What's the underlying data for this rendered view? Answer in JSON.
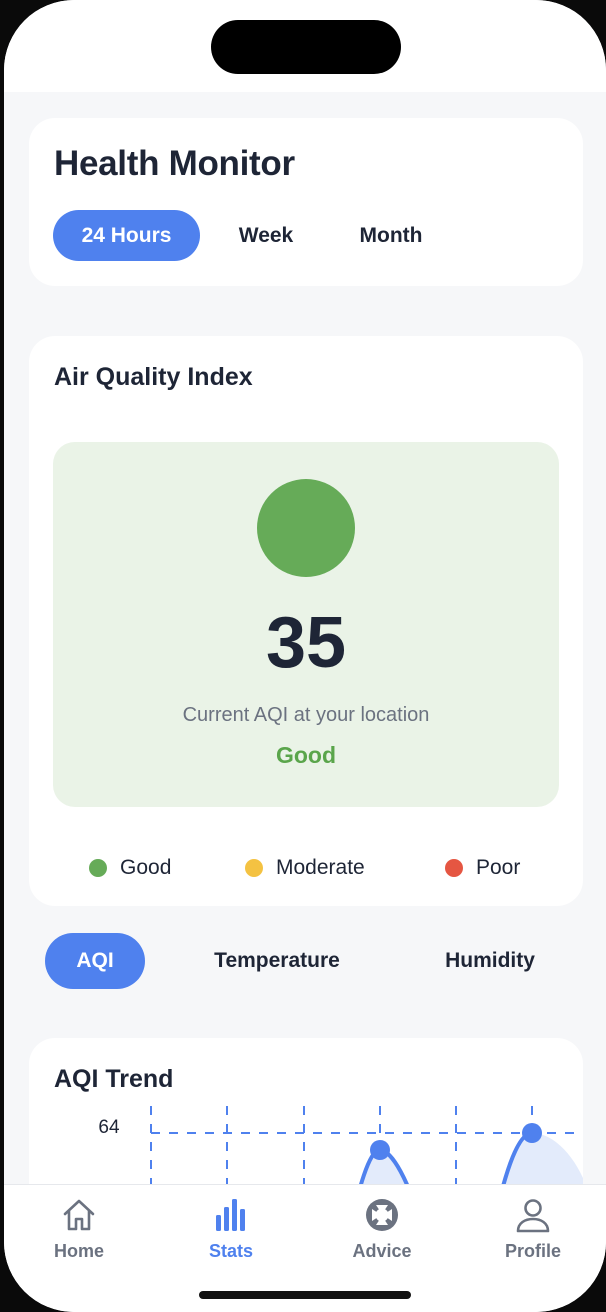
{
  "header": {
    "title": "Health Monitor",
    "periods": [
      "24 Hours",
      "Week",
      "Month"
    ],
    "active_period": "24 Hours"
  },
  "aqi": {
    "title": "Air Quality Index",
    "value": "35",
    "caption": "Current AQI at your location",
    "status": "Good",
    "status_color": "#5aa54b",
    "dot_color": "#66ab58",
    "legend": [
      {
        "label": "Good",
        "color": "#66ab58"
      },
      {
        "label": "Moderate",
        "color": "#f4c242"
      },
      {
        "label": "Poor",
        "color": "#e55642"
      }
    ]
  },
  "metric_tabs": {
    "items": [
      "AQI",
      "Temperature",
      "Humidity"
    ],
    "active": "AQI"
  },
  "trend": {
    "title": "AQI Trend",
    "y_tick_labels": [
      "64"
    ]
  },
  "chart_data": {
    "type": "line",
    "title": "AQI Trend",
    "y_ticks": [
      64
    ],
    "series": [
      {
        "values": [
          64,
          64
        ]
      }
    ]
  },
  "tab_bar": {
    "items": [
      {
        "label": "Home",
        "icon": "home-icon"
      },
      {
        "label": "Stats",
        "icon": "stats-icon"
      },
      {
        "label": "Advice",
        "icon": "lifebuoy-icon"
      },
      {
        "label": "Profile",
        "icon": "profile-icon"
      }
    ],
    "active": "Stats"
  },
  "colors": {
    "accent": "#4f81ee",
    "text_dark": "#1e2536",
    "text_muted": "#6b7280"
  }
}
